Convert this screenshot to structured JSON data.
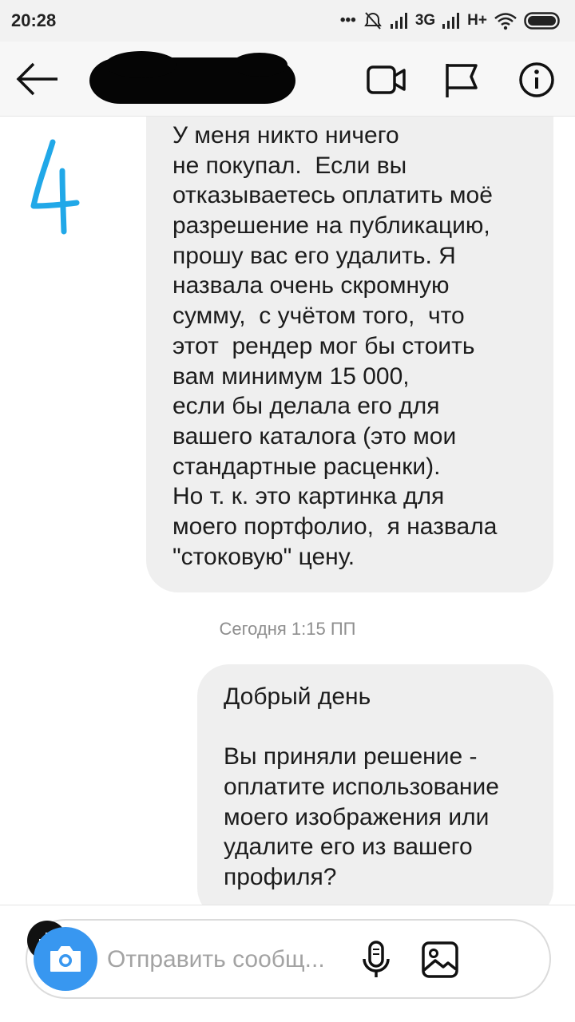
{
  "status_bar": {
    "time": "20:28",
    "network_1": "3G",
    "network_2": "H+"
  },
  "header": {
    "contact_name": "",
    "back_icon": "arrow-left-icon",
    "video_icon": "video-camera-icon",
    "flag_icon": "flag-icon",
    "info_icon": "info-icon"
  },
  "annotation": {
    "text": "4",
    "color": "#21a8e8"
  },
  "messages": [
    {
      "lines": [
        "У меня никто ничего",
        "не покупал.  Если вы",
        "отказываетесь оплатить моё",
        "разрешение на публикацию,",
        "прошу вас его удалить. Я",
        "назвала очень скромную",
        "сумму,  с учётом того,  что",
        "этот  рендер мог бы стоить",
        "вам минимум 15 000,",
        "если бы делала его для",
        "вашего каталога (это мои",
        "стандартные расценки).",
        "Но т. к. это картинка для",
        "моего портфолио,  я назвала",
        "\"стоковую\" цену."
      ]
    },
    {
      "lines": [
        "Добрый день",
        "",
        "Вы приняли решение -",
        "оплатите использование",
        "моего изображения или",
        "удалите его из вашего",
        "профиля?"
      ]
    }
  ],
  "timestamp": "Сегодня 1:15 ПП",
  "composer": {
    "placeholder": "Отправить сообщ...",
    "camera_icon": "camera-icon",
    "mic_icon": "microphone-icon",
    "gallery_icon": "image-gallery-icon",
    "plus_icon": "plus-icon"
  },
  "colors": {
    "accent": "#3897f0",
    "bubble": "#efefef"
  }
}
